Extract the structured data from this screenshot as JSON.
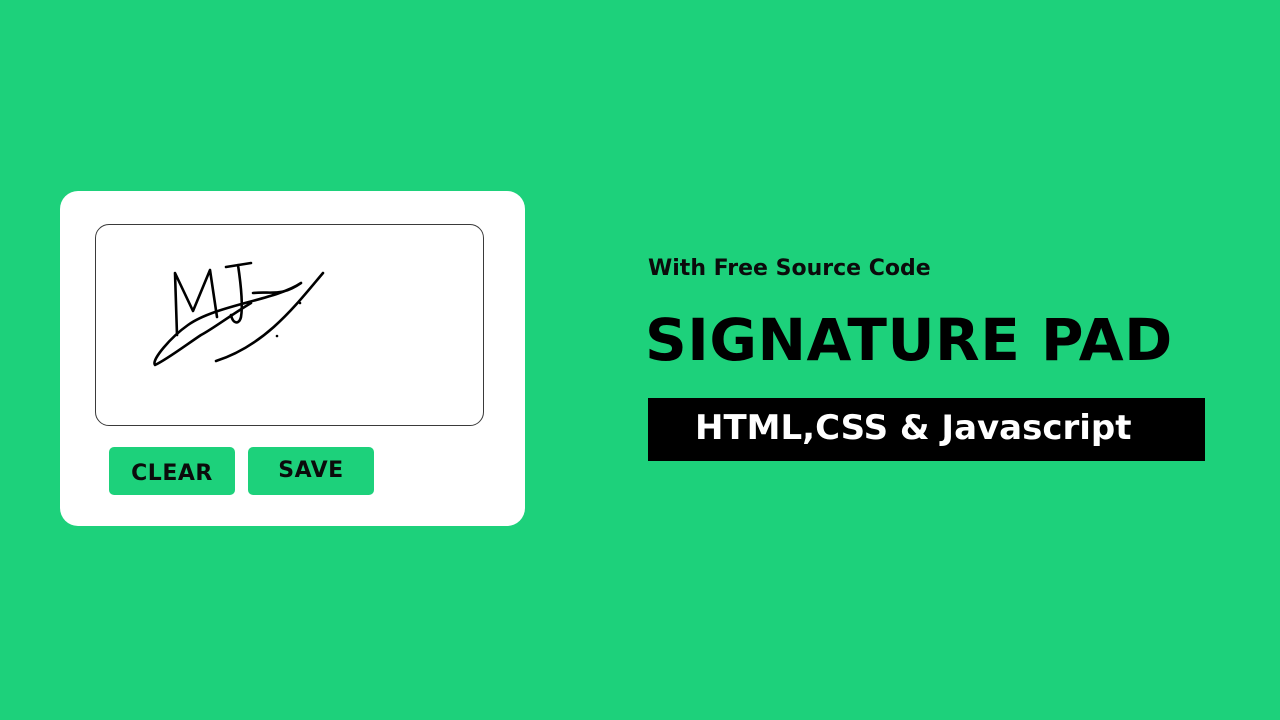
{
  "pad": {
    "clear_label": "CLEAR",
    "save_label": "SAVE"
  },
  "promo": {
    "subtitle": "With Free Source Code",
    "title": "SIGNATURE PAD",
    "banner": "HTML,CSS & Javascript"
  },
  "colors": {
    "background": "#1dd17b",
    "card": "#ffffff",
    "button": "#1dd17b",
    "banner": "#000000",
    "ink": "#000000"
  }
}
